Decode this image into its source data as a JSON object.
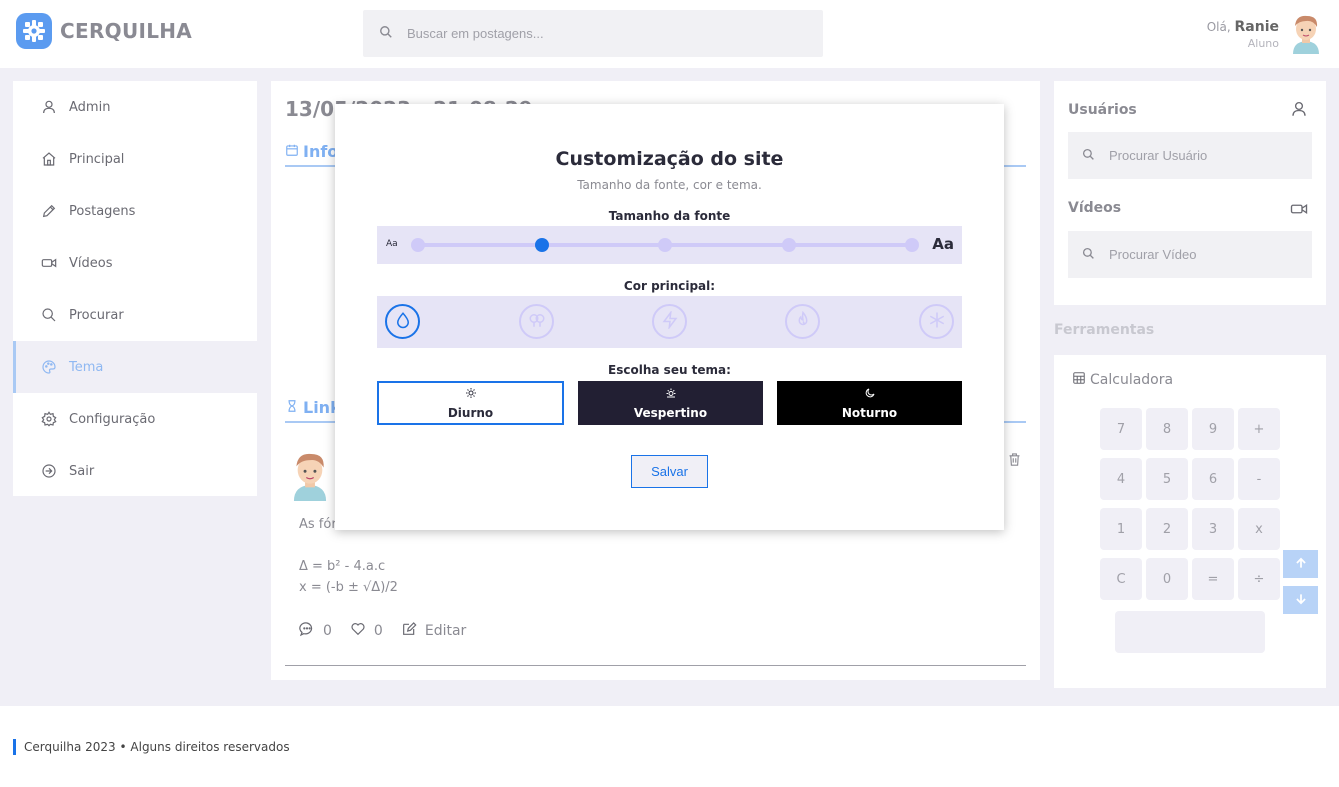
{
  "header": {
    "brand": "CERQUILHA",
    "search_placeholder": "Buscar em postagens...",
    "greeting": "Olá,",
    "user_name": "Ranie",
    "user_role": "Aluno"
  },
  "sidebar": {
    "items": [
      {
        "label": "Admin",
        "icon": "user-icon"
      },
      {
        "label": "Principal",
        "icon": "home-icon"
      },
      {
        "label": "Postagens",
        "icon": "pencil-icon"
      },
      {
        "label": "Vídeos",
        "icon": "video-icon"
      },
      {
        "label": "Procurar",
        "icon": "search-icon"
      },
      {
        "label": "Tema",
        "icon": "palette-icon",
        "active": true
      },
      {
        "label": "Configuração",
        "icon": "gear-icon"
      },
      {
        "label": "Sair",
        "icon": "logout-icon"
      }
    ]
  },
  "main": {
    "post_date": "13/05/2023 - 21:08:29",
    "section_info": "Informações",
    "section_links": "Links",
    "post_lines": [
      "As fórmulas de Bhaskara:",
      "",
      "Δ = b² - 4.a.c",
      "x = (-b ± √Δ)/2"
    ],
    "comments_count": "0",
    "likes_count": "0",
    "edit_label": "Editar"
  },
  "right": {
    "users_title": "Usuários",
    "users_placeholder": "Procurar Usuário",
    "videos_title": "Vídeos",
    "videos_placeholder": "Procurar Vídeo",
    "tools_title": "Ferramentas",
    "calculator_title": "Calculadora",
    "calculator_keys": [
      "7",
      "8",
      "9",
      "+",
      "4",
      "5",
      "6",
      "-",
      "1",
      "2",
      "3",
      "x",
      "C",
      "0",
      "=",
      "÷"
    ]
  },
  "footer": {
    "text": "Cerquilha 2023 • Alguns direitos reservados"
  },
  "modal": {
    "title": "Customização do site",
    "subtitle": "Tamanho da fonte, cor e tema.",
    "font_size_label": "Tamanho da fonte",
    "font_small": "Aa",
    "font_big": "Aa",
    "font_size_selected_index": 1,
    "font_size_steps": 5,
    "color_label": "Cor principal:",
    "colors": [
      "water-drop-icon",
      "tree-icon",
      "lightning-icon",
      "fire-icon",
      "snowflake-icon"
    ],
    "color_selected_index": 0,
    "theme_label": "Escolha seu tema:",
    "themes": [
      {
        "label": "Diurno",
        "icon": "sun-icon",
        "bg": "#ffffff",
        "fg": "#2b2b3a",
        "selected": true
      },
      {
        "label": "Vespertino",
        "icon": "sunset-icon",
        "bg": "#221f33",
        "fg": "#ffffff",
        "selected": false
      },
      {
        "label": "Noturno",
        "icon": "moon-icon",
        "bg": "#000000",
        "fg": "#ffffff",
        "selected": false
      }
    ],
    "save_label": "Salvar"
  },
  "colors": {
    "accent": "#1a73e8",
    "light_accent": "#a9c9f4",
    "panel_bg": "#f0eff6",
    "lavender": "#e6e4f6"
  }
}
